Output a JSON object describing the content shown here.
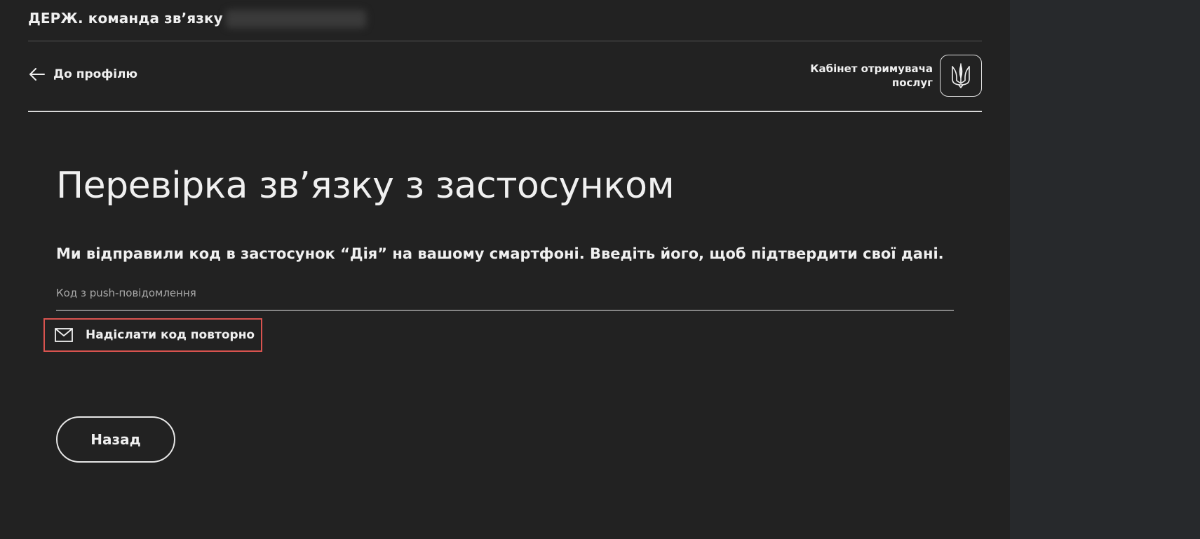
{
  "org": {
    "name": "ДЕРЖ. команда зв’язку"
  },
  "header": {
    "back_label": "До профілю",
    "cabinet_line1": "Кабінет отримувача",
    "cabinet_line2": "послуг"
  },
  "main": {
    "title": "Перевірка зв’язку з застосунком",
    "description": "Ми відправили код в застосунок “Дія” на вашому смартфоні. Введіть його, щоб підтвердити свої дані.",
    "code_placeholder": "Код з push-повідомлення",
    "code_value": "",
    "resend_label": "Надіслати код повторно",
    "back_button_label": "Назад"
  },
  "icons": {
    "back": "arrow-left-icon",
    "trident": "trident-icon",
    "resend": "envelope-icon"
  },
  "colors": {
    "background": "#222222",
    "right_panel": "#27292c",
    "highlight_border": "#d9534f",
    "text": "#f0f0f0"
  }
}
